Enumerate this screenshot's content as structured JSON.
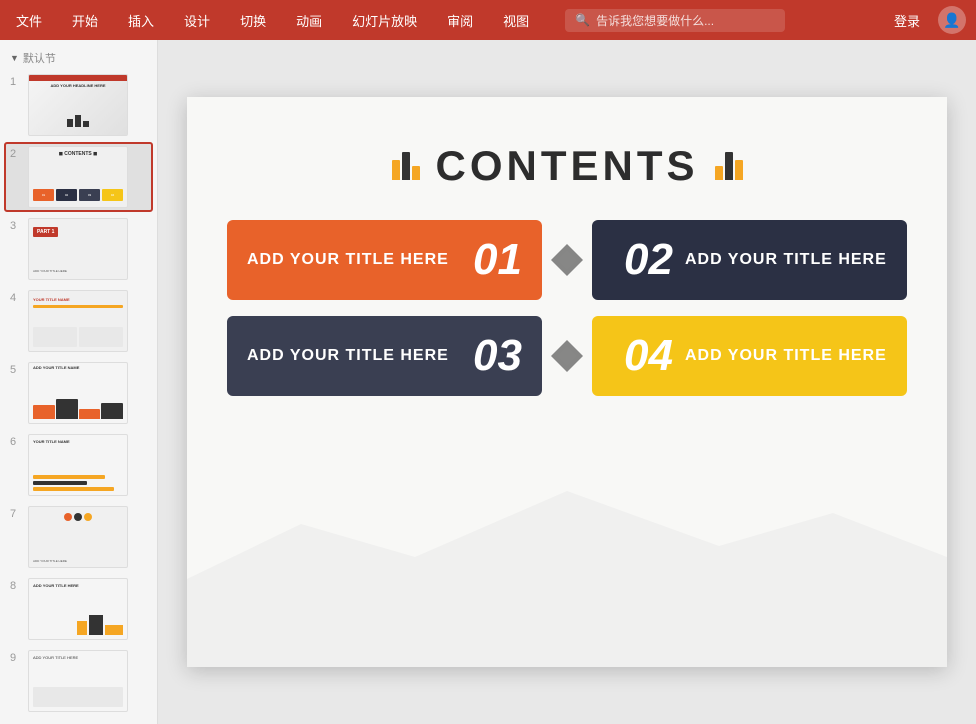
{
  "menubar": {
    "items": [
      "文件",
      "开始",
      "插入",
      "设计",
      "切换",
      "动画",
      "幻灯片放映",
      "审阅",
      "视图"
    ],
    "search_placeholder": "告诉我您想要做什么...",
    "login": "登录",
    "colors": {
      "bg": "#c0392b"
    }
  },
  "sidebar": {
    "section_label": "默认节",
    "slides": [
      {
        "num": "1",
        "active": false
      },
      {
        "num": "2",
        "active": true
      },
      {
        "num": "3",
        "active": false
      },
      {
        "num": "4",
        "active": false
      },
      {
        "num": "5",
        "active": false
      },
      {
        "num": "6",
        "active": false
      },
      {
        "num": "7",
        "active": false
      },
      {
        "num": "8",
        "active": false
      },
      {
        "num": "9",
        "active": false
      }
    ]
  },
  "slide": {
    "title": "CONTENTS",
    "rows": [
      {
        "left": {
          "text": "ADD YOUR TITLE HERE",
          "number": "01",
          "color": "orange"
        },
        "right": {
          "text": "ADD YOUR TITLE HERE",
          "number": "02",
          "color": "dark"
        }
      },
      {
        "left": {
          "text": "ADD YOUR TITLE HERE",
          "number": "03",
          "color": "gray"
        },
        "right": {
          "text": "ADD YOUR TITLE HERE",
          "number": "04",
          "color": "yellow"
        }
      }
    ]
  }
}
